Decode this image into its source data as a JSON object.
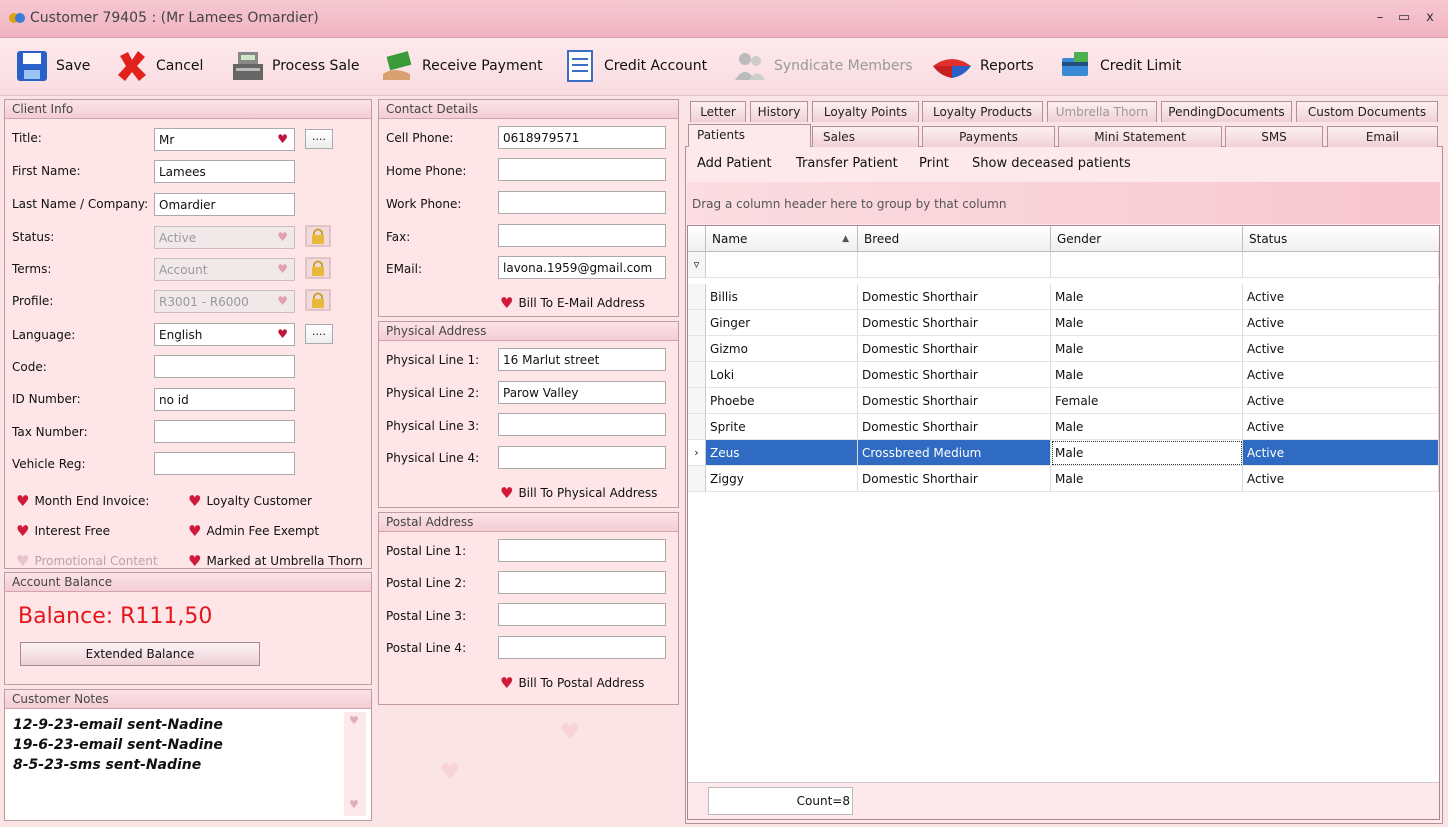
{
  "window": {
    "title": "Customer 79405 : (Mr Lamees Omardier)",
    "app_icon": "app-logo-icon",
    "controls": [
      "–",
      "▭",
      "x"
    ]
  },
  "toolbar": {
    "save": "Save",
    "cancel": "Cancel",
    "process_sale": "Process Sale",
    "receive_payment": "Receive Payment",
    "credit_account": "Credit Account",
    "syndicate_members": "Syndicate Members",
    "reports": "Reports",
    "credit_limit": "Credit Limit"
  },
  "client_info": {
    "header": "Client Info",
    "title_label": "Title:",
    "title_value": "Mr",
    "first_name_label": "First Name:",
    "first_name_value": "Lamees",
    "last_name_label": "Last Name / Company:",
    "last_name_value": "Omardier",
    "status_label": "Status:",
    "status_value": "Active",
    "terms_label": "Terms:",
    "terms_value": "Account",
    "profile_label": "Profile:",
    "profile_value": "R3001 - R6000",
    "language_label": "Language:",
    "language_value": "English",
    "code_label": "Code:",
    "code_value": "",
    "id_label": "ID Number:",
    "id_value": "no id",
    "tax_label": "Tax Number:",
    "tax_value": "",
    "vehicle_label": "Vehicle Reg:",
    "vehicle_value": "",
    "dots": "....",
    "checks": {
      "month_end": "Month End Invoice:",
      "loyalty": "Loyalty Customer",
      "interest_free": "Interest Free",
      "admin_fee": "Admin Fee Exempt",
      "promotional": "Promotional Content",
      "umbrella": "Marked at Umbrella Thorn"
    }
  },
  "account_balance": {
    "header": "Account Balance",
    "balance": "Balance: R111,50",
    "extended_button": "Extended Balance"
  },
  "customer_notes": {
    "header": "Customer Notes",
    "lines": [
      "12-9-23-email sent-Nadine",
      "19-6-23-email sent-Nadine",
      "8-5-23-sms sent-Nadine"
    ]
  },
  "contact": {
    "header": "Contact Details",
    "cell_label": "Cell Phone:",
    "cell_value": "0618979571",
    "home_label": "Home Phone:",
    "home_value": "",
    "work_label": "Work Phone:",
    "work_value": "",
    "fax_label": "Fax:",
    "fax_value": "",
    "email_label": "EMail:",
    "email_value": "lavona.1959@gmail.com",
    "bill_email": "Bill To E-Mail Address"
  },
  "physical": {
    "header": "Physical Address",
    "l1_label": "Physical Line 1:",
    "l1_value": "16 Marlut street",
    "l2_label": "Physical Line 2:",
    "l2_value": "Parow Valley",
    "l3_label": "Physical Line 3:",
    "l3_value": "",
    "l4_label": "Physical Line 4:",
    "l4_value": "",
    "bill": "Bill To Physical Address"
  },
  "postal": {
    "header": "Postal Address",
    "l1_label": "Postal Line 1:",
    "l1_value": "",
    "l2_label": "Postal Line 2:",
    "l2_value": "",
    "l3_label": "Postal Line 3:",
    "l3_value": "",
    "l4_label": "Postal Line 4:",
    "l4_value": "",
    "bill": "Bill To Postal Address"
  },
  "tabs": {
    "row1": [
      "Letter",
      "History",
      "Loyalty Points",
      "Loyalty Products",
      "Umbrella Thorn",
      "PendingDocuments",
      "Custom Documents"
    ],
    "row2": [
      "Patients",
      "Sales",
      "Payments",
      "Mini Statement",
      "SMS",
      "Email"
    ]
  },
  "patients": {
    "actions": [
      "Add Patient",
      "Transfer Patient",
      "Print",
      "Show deceased patients"
    ],
    "group_hint": "Drag a column header here to group by that column",
    "columns": [
      "Name",
      "Breed",
      "Gender",
      "Status"
    ],
    "rows": [
      [
        "Billis",
        "Domestic Shorthair",
        "Male",
        "Active"
      ],
      [
        "Ginger",
        "Domestic Shorthair",
        "Male",
        "Active"
      ],
      [
        "Gizmo",
        "Domestic Shorthair",
        "Male",
        "Active"
      ],
      [
        "Loki",
        "Domestic Shorthair",
        "Male",
        "Active"
      ],
      [
        "Phoebe",
        "Domestic Shorthair",
        "Female",
        "Active"
      ],
      [
        "Sprite",
        "Domestic Shorthair",
        "Male",
        "Active"
      ],
      [
        "Zeus",
        "Crossbreed Medium",
        "Male",
        "Active"
      ],
      [
        "Ziggy",
        "Domestic Shorthair",
        "Male",
        "Active"
      ]
    ],
    "selected_row": 6,
    "count": "Count=8"
  },
  "colors": {
    "accent_red": "#e4161c",
    "selection": "#2f6bc2",
    "background": "#fbe4e6"
  }
}
